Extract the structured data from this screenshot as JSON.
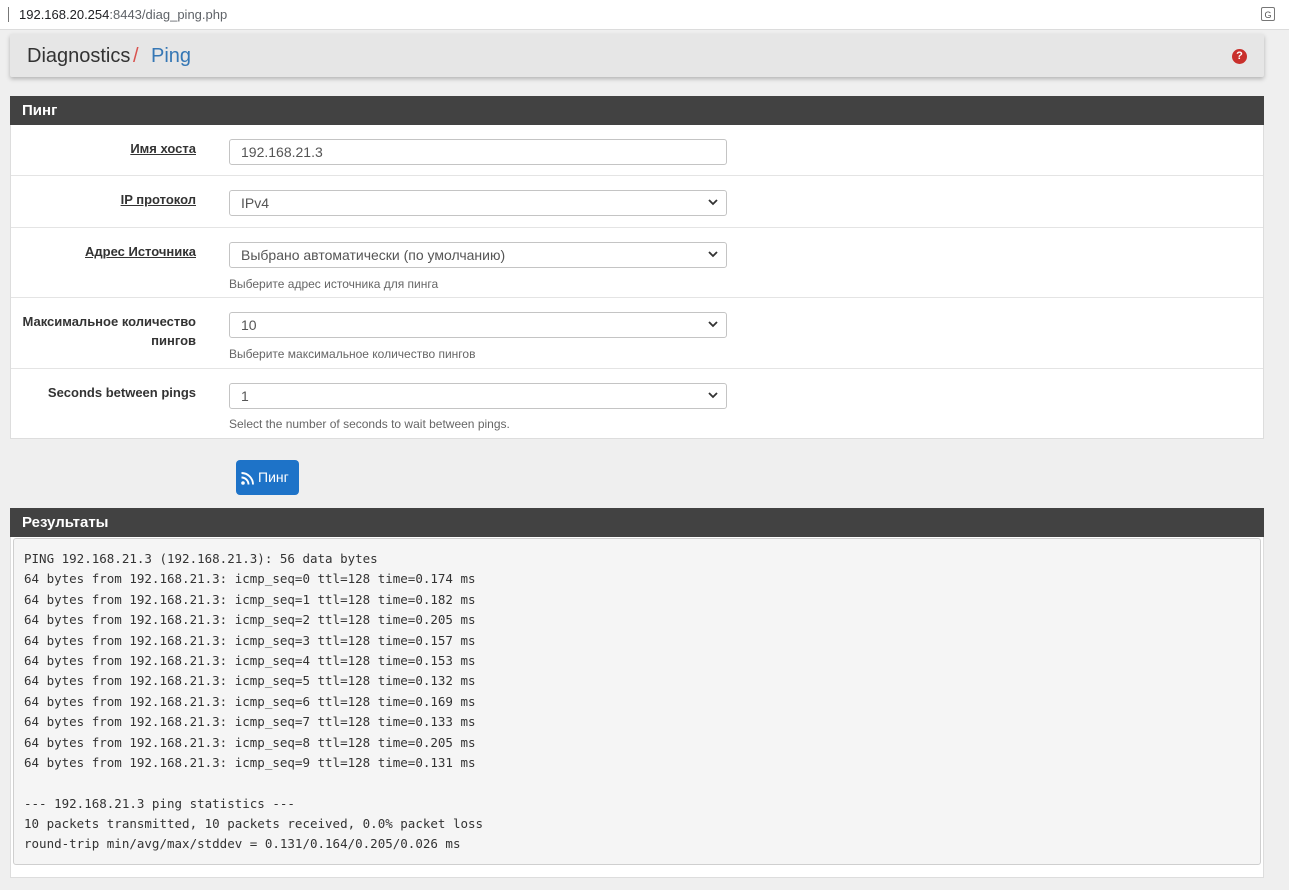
{
  "browser": {
    "url_host": "192.168.20.254",
    "url_rest": ":8443/diag_ping.php"
  },
  "breadcrumb": {
    "parent": "Diagnostics",
    "separator": "/",
    "current": "Ping",
    "help": "?"
  },
  "form": {
    "title": "Пинг",
    "host": {
      "label": "Имя хоста",
      "value": "192.168.21.3"
    },
    "protocol": {
      "label": "IP протокол",
      "value": "IPv4"
    },
    "source": {
      "label": "Адрес Источника",
      "value": "Выбрано автоматически (по умолчанию)",
      "help": "Выберите адрес источника для пинга"
    },
    "count": {
      "label_line1": "Максимальное количество",
      "label_line2": "пингов",
      "value": "10",
      "help": "Выберите максимальное количество пингов"
    },
    "interval": {
      "label": "Seconds between pings",
      "value": "1",
      "help": "Select the number of seconds to wait between pings."
    }
  },
  "ping_button": {
    "label": "Пинг"
  },
  "results": {
    "title": "Результаты",
    "lines": [
      "PING 192.168.21.3 (192.168.21.3): 56 data bytes",
      "64 bytes from 192.168.21.3: icmp_seq=0 ttl=128 time=0.174 ms",
      "64 bytes from 192.168.21.3: icmp_seq=1 ttl=128 time=0.182 ms",
      "64 bytes from 192.168.21.3: icmp_seq=2 ttl=128 time=0.205 ms",
      "64 bytes from 192.168.21.3: icmp_seq=3 ttl=128 time=0.157 ms",
      "64 bytes from 192.168.21.3: icmp_seq=4 ttl=128 time=0.153 ms",
      "64 bytes from 192.168.21.3: icmp_seq=5 ttl=128 time=0.132 ms",
      "64 bytes from 192.168.21.3: icmp_seq=6 ttl=128 time=0.169 ms",
      "64 bytes from 192.168.21.3: icmp_seq=7 ttl=128 time=0.133 ms",
      "64 bytes from 192.168.21.3: icmp_seq=8 ttl=128 time=0.205 ms",
      "64 bytes from 192.168.21.3: icmp_seq=9 ttl=128 time=0.131 ms",
      "",
      "--- 192.168.21.3 ping statistics ---",
      "10 packets transmitted, 10 packets received, 0.0% packet loss",
      "round-trip min/avg/max/stddev = 0.131/0.164/0.205/0.026 ms"
    ]
  },
  "icons": {
    "translate": "translate-icon",
    "help": "question-circle-icon",
    "dropdown": "chevron-down-icon",
    "rss": "rss-icon"
  },
  "colors": {
    "panel_header": "#424242",
    "accent_blue": "#1e73c8",
    "breadcrumb_link": "#3577b5",
    "help_red": "#c9302c"
  }
}
